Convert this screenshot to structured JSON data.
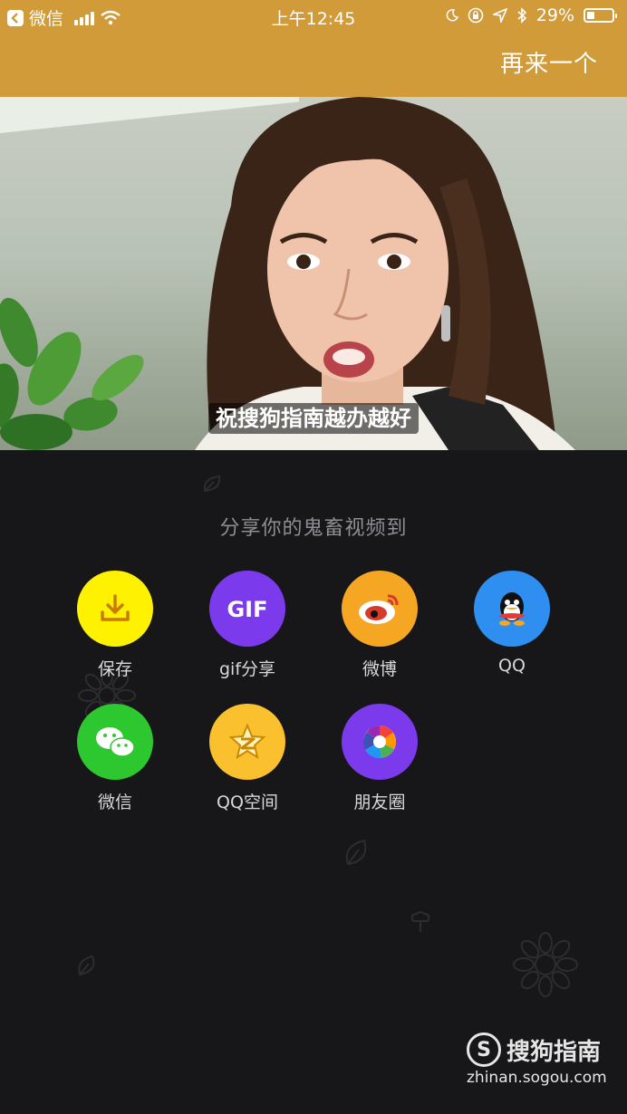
{
  "status_bar": {
    "back_app": "微信",
    "time": "上午12:45",
    "battery_text": "29%",
    "battery_level": 0.29
  },
  "header": {
    "again_label": "再来一个"
  },
  "video": {
    "subtitle": "祝搜狗指南越办越好"
  },
  "share": {
    "title": "分享你的鬼畜视频到",
    "items": [
      {
        "label": "保存",
        "icon": "download-icon",
        "color": "#fff200"
      },
      {
        "label": "gif分享",
        "icon": "gif-icon",
        "color": "#7c3aed"
      },
      {
        "label": "微博",
        "icon": "weibo-icon",
        "color": "#f5a623"
      },
      {
        "label": "QQ",
        "icon": "qq-icon",
        "color": "#2f8ff0"
      },
      {
        "label": "微信",
        "icon": "wechat-icon",
        "color": "#2dc82f"
      },
      {
        "label": "QQ空间",
        "icon": "qzone-icon",
        "color": "#fbc02d"
      },
      {
        "label": "朋友圈",
        "icon": "moments-icon",
        "color": "#7c3aed"
      }
    ]
  },
  "watermark": {
    "name": "搜狗指南",
    "url": "zhinan.sogou.com"
  }
}
